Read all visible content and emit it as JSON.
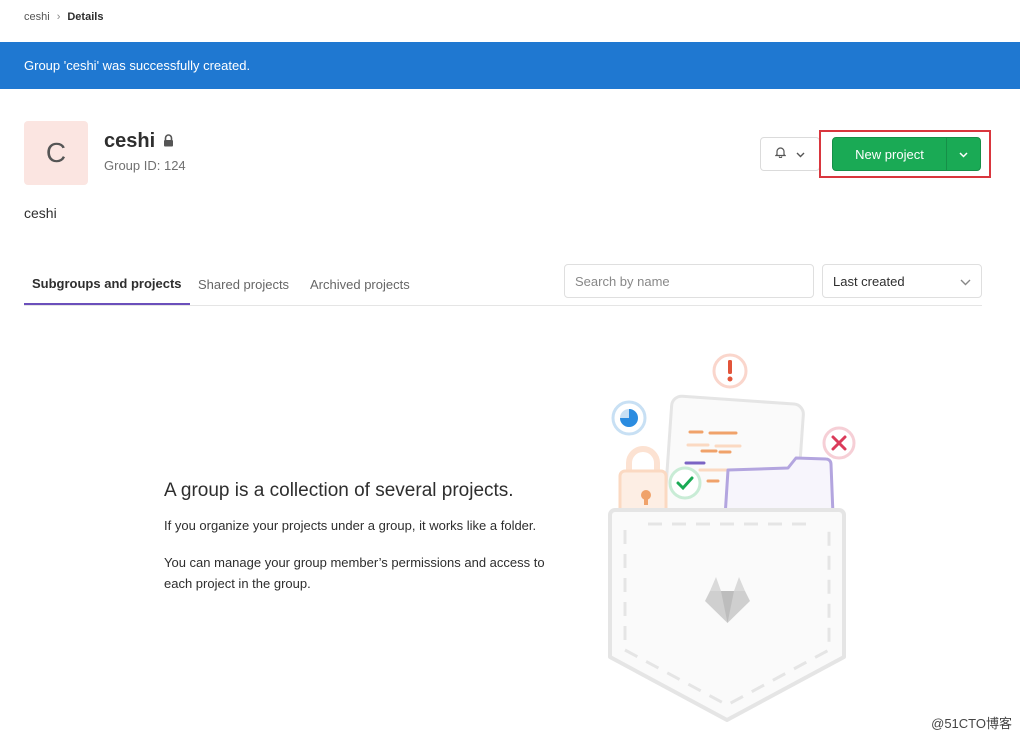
{
  "breadcrumb": {
    "parent": "ceshi",
    "current": "Details"
  },
  "flash": {
    "message": "Group 'ceshi' was successfully created."
  },
  "group": {
    "avatar_letter": "C",
    "name": "ceshi",
    "id_label": "Group ID: 124",
    "description": "ceshi"
  },
  "actions": {
    "new_project_label": "New project"
  },
  "tabs": [
    {
      "label": "Subgroups and projects",
      "active": true
    },
    {
      "label": "Shared projects",
      "active": false
    },
    {
      "label": "Archived projects",
      "active": false
    }
  ],
  "filter": {
    "search_placeholder": "Search by name",
    "sort_selected": "Last created"
  },
  "empty_state": {
    "title": "A group is a collection of several projects.",
    "line1": "If you organize your projects under a group, it works like a folder.",
    "line2": "You can manage your group member’s permissions and access to each project in the group."
  },
  "watermark": "@51CTO博客",
  "colors": {
    "flash_blue": "#1f78d1",
    "new_project_green": "#1aaa55",
    "tab_active_underline": "#6b4fbb",
    "highlight_red": "#d9363e"
  },
  "icons": [
    "chevron-right-icon",
    "lock-icon",
    "bell-icon",
    "chevron-down-icon"
  ]
}
